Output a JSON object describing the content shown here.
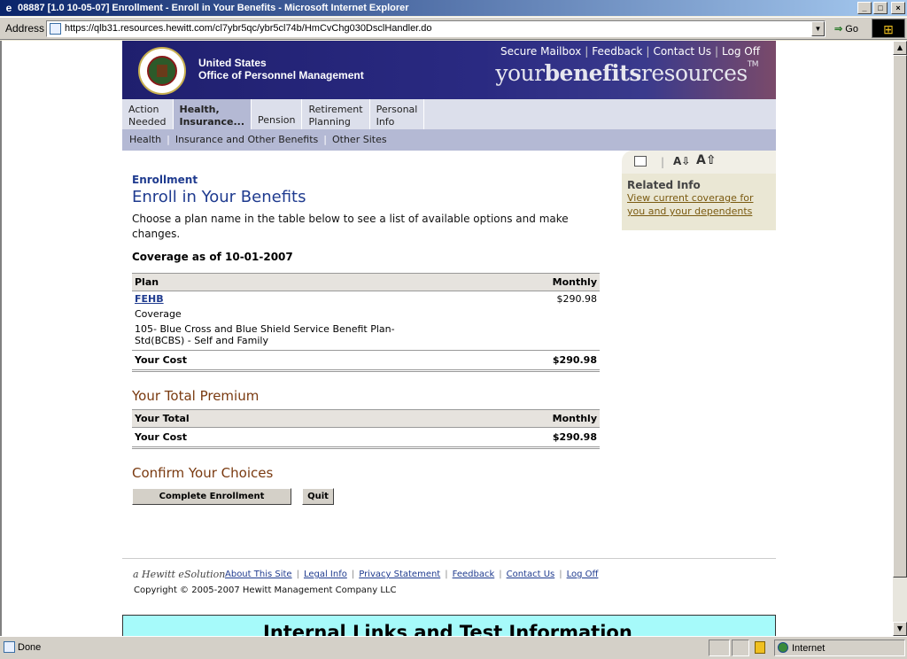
{
  "window": {
    "title": "08887 [1.0 10-05-07] Enrollment - Enroll in Your Benefits - Microsoft Internet Explorer",
    "address_label": "Address",
    "url": "https://qlb31.resources.hewitt.com/cl7ybr5qc/ybr5cl74b/HmCvChg030DsclHandler.do",
    "go_label": "Go"
  },
  "header": {
    "org_line1": "United States",
    "org_line2": "Office of Personnel Management",
    "links": [
      "Secure Mailbox",
      "Feedback",
      "Contact Us",
      "Log Off"
    ],
    "brand_pre": "your",
    "brand_bold": "benefits",
    "brand_post": "resources",
    "brand_tm": "TM"
  },
  "nav": {
    "items": [
      {
        "line1": "Action",
        "line2": "Needed"
      },
      {
        "line1": "Health,",
        "line2": "Insurance..."
      },
      {
        "line1": "Pension",
        "line2": ""
      },
      {
        "line1": "Retirement",
        "line2": "Planning"
      },
      {
        "line1": "Personal",
        "line2": "Info"
      }
    ],
    "sub": [
      "Health",
      "Insurance and Other Benefits",
      "Other Sites"
    ]
  },
  "tools": {
    "font_down": "A⇩",
    "font_up": "A⇧"
  },
  "related": {
    "title": "Related Info",
    "link": "View current coverage for you and your dependents"
  },
  "main": {
    "kicker": "Enrollment",
    "title": "Enroll in Your Benefits",
    "intro": "Choose a plan name in the table below to see a list of available options and make changes.",
    "coverage": "Coverage as of 10-01-2007",
    "plan_table": {
      "col_plan": "Plan",
      "col_monthly": "Monthly",
      "plan_name": "FEHB",
      "plan_amount": "$290.98",
      "coverage_label": "Coverage",
      "coverage_desc": "105- Blue Cross and Blue Shield Service Benefit Plan-Std(BCBS) - Self and Family",
      "total_label": "Your Cost",
      "total_amount": "$290.98"
    },
    "premium_title": "Your Total Premium",
    "premium_table": {
      "col_total": "Your Total",
      "col_monthly": "Monthly",
      "total_label": "Your Cost",
      "total_amount": "$290.98"
    },
    "confirm_title": "Confirm Your Choices",
    "complete_button": "Complete Enrollment",
    "quit_button": "Quit"
  },
  "footer": {
    "logo": "a Hewitt eSolution",
    "links": [
      "About This Site",
      "Legal Info",
      "Privacy Statement",
      "Feedback",
      "Contact Us",
      "Log Off"
    ],
    "copyright": "Copyright © 2005-2007 Hewitt Management Company LLC"
  },
  "internal_banner": "Internal Links and Test Information",
  "status": {
    "text": "Done",
    "zone": "Internet"
  }
}
